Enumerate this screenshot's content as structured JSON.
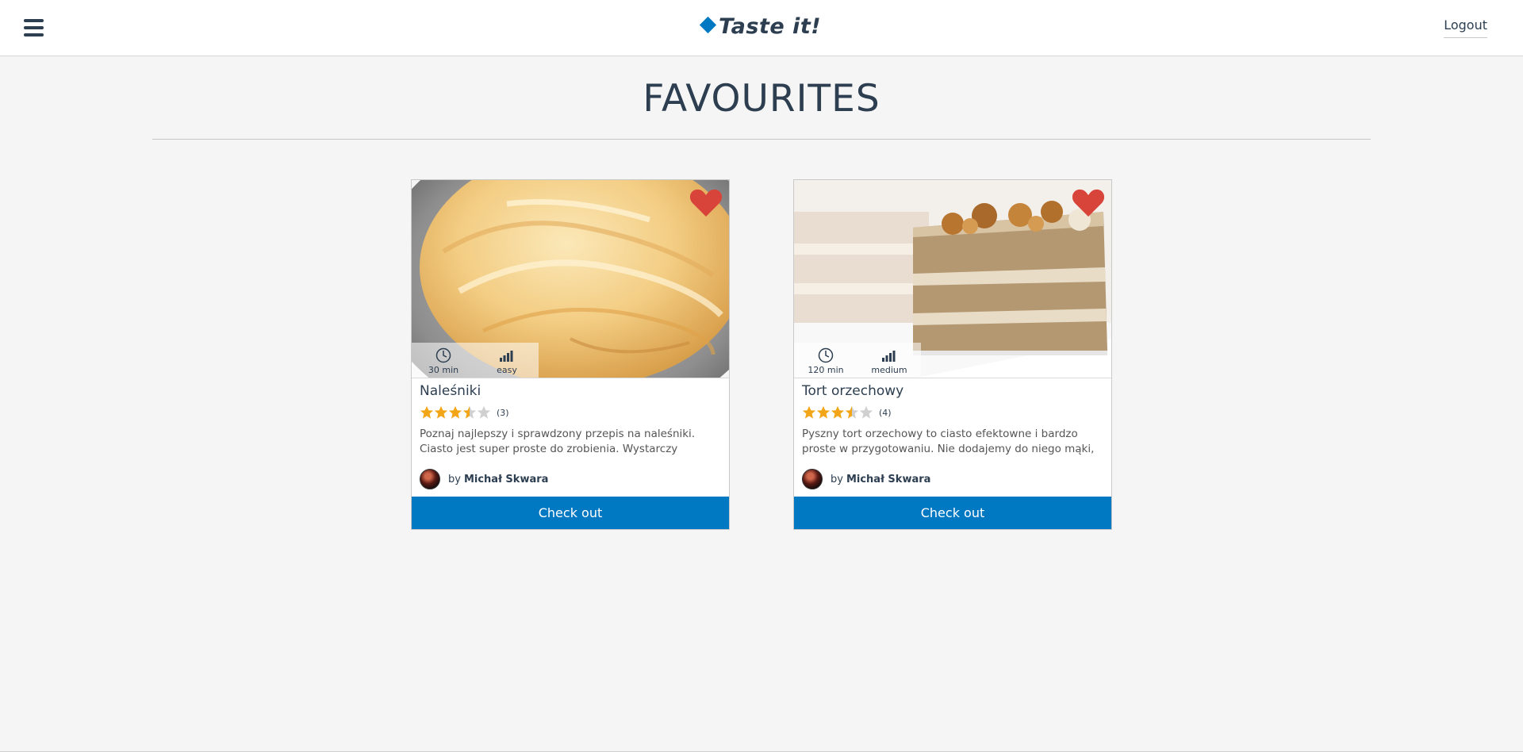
{
  "header": {
    "logo_text": "Taste it!",
    "logout_label": "Logout"
  },
  "page": {
    "title": "FAVOURITES"
  },
  "recipes": [
    {
      "title": "Naleśniki",
      "time": "30 min",
      "difficulty": "easy",
      "rating": 3.5,
      "rating_count": "(3)",
      "description": "Poznaj najlepszy i sprawdzony przepis na naleśniki. Ciasto jest super proste do zrobienia. Wystarczy zmiksować...",
      "author_prefix": "by",
      "author": "Michał Skwara",
      "button_label": "Check out",
      "favourite": true
    },
    {
      "title": "Tort orzechowy",
      "time": "120 min",
      "difficulty": "medium",
      "rating": 3.5,
      "rating_count": "(4)",
      "description": "Pyszny tort orzechowy to ciasto efektowne i bardzo proste w przygotowaniu. Nie dodajemy do niego mąki, za to...",
      "author_prefix": "by",
      "author": "Michał Skwara",
      "button_label": "Check out",
      "favourite": true
    }
  ],
  "colors": {
    "accent": "#0178c2",
    "heart": "#d9443a",
    "star": "#f2a516",
    "text": "#2c3e50"
  },
  "icons": [
    "menu-icon",
    "logo-diamond-icon",
    "heart-icon",
    "clock-icon",
    "difficulty-bars-icon",
    "star-icon"
  ]
}
